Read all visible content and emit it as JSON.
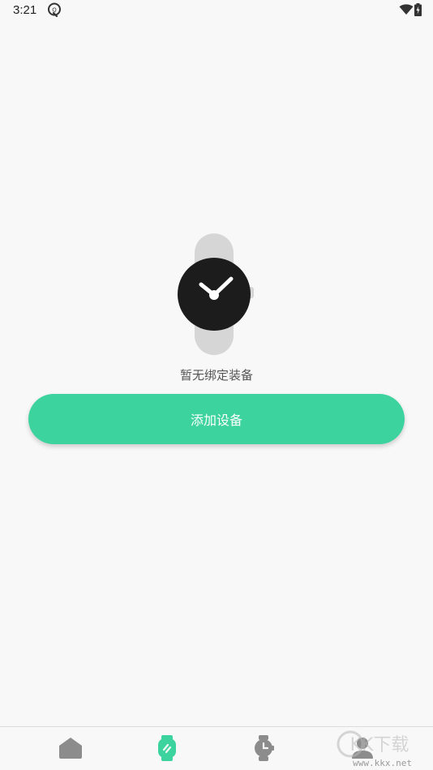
{
  "status_bar": {
    "time": "3:21",
    "app_icon": "q-notification-icon",
    "wifi_icon": "wifi-icon",
    "battery_icon": "battery-charging-icon"
  },
  "empty_state": {
    "illustration": "watch-icon",
    "message": "暂无绑定装备",
    "button_label": "添加设备"
  },
  "bottom_nav": {
    "items": [
      {
        "icon": "home-icon",
        "active": false
      },
      {
        "icon": "device-icon",
        "active": true
      },
      {
        "icon": "watch-clock-icon",
        "active": false
      },
      {
        "icon": "profile-icon",
        "active": false
      }
    ]
  },
  "watermark": {
    "brand": "KK下载",
    "url": "www.kkx.net"
  },
  "colors": {
    "accent": "#3cd39f",
    "background": "#f8f8f8",
    "inactive_icon": "#8c8c8c",
    "watch_face": "#1c1c1c",
    "watch_strap": "#d6d6d6"
  }
}
